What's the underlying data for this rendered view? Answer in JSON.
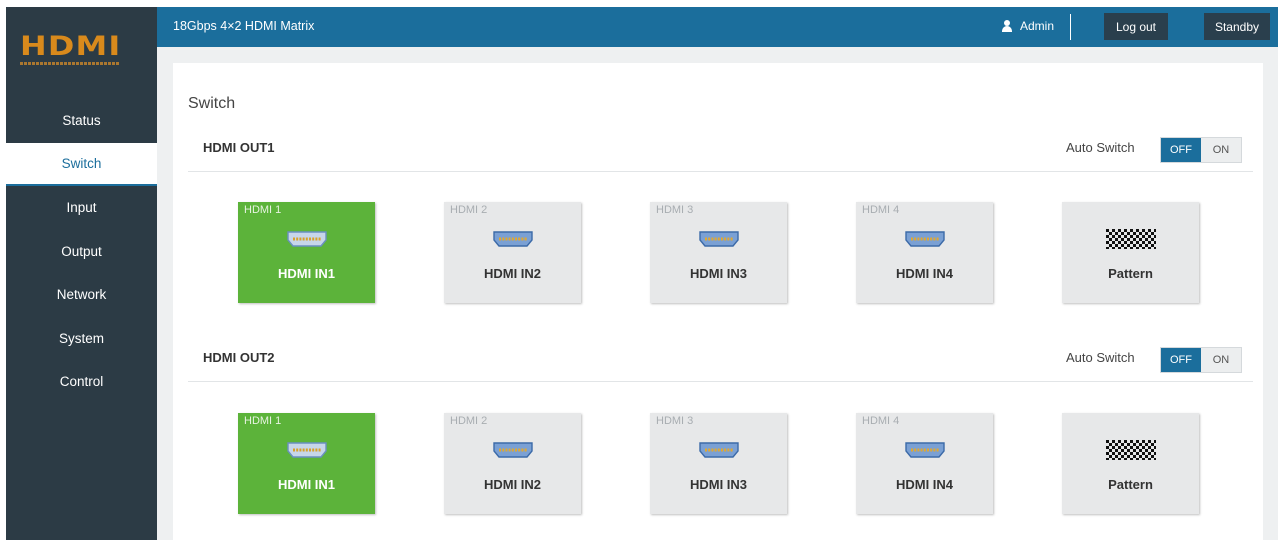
{
  "app": {
    "logo": "HDMI",
    "title": "18Gbps 4×2 HDMI Matrix",
    "user": "Admin",
    "logout_label": "Log out",
    "standby_label": "Standby"
  },
  "nav": {
    "items": [
      {
        "label": "Status",
        "active": false
      },
      {
        "label": "Switch",
        "active": true
      },
      {
        "label": "Input",
        "active": false
      },
      {
        "label": "Output",
        "active": false
      },
      {
        "label": "Network",
        "active": false
      },
      {
        "label": "System",
        "active": false
      },
      {
        "label": "Control",
        "active": false
      }
    ]
  },
  "page": {
    "title": "Switch",
    "outputs": [
      {
        "label": "HDMI OUT1",
        "auto_switch_label": "Auto Switch",
        "off_label": "OFF",
        "on_label": "ON",
        "auto_switch": "OFF",
        "sources": [
          {
            "tag": "HDMI 1",
            "name": "HDMI IN1",
            "icon": "hdmi-port-icon",
            "selected": true
          },
          {
            "tag": "HDMI 2",
            "name": "HDMI IN2",
            "icon": "hdmi-port-icon",
            "selected": false
          },
          {
            "tag": "HDMI 3",
            "name": "HDMI IN3",
            "icon": "hdmi-port-icon",
            "selected": false
          },
          {
            "tag": "HDMI 4",
            "name": "HDMI IN4",
            "icon": "hdmi-port-icon",
            "selected": false
          },
          {
            "tag": "",
            "name": "Pattern",
            "icon": "checker-pattern-icon",
            "selected": false
          }
        ]
      },
      {
        "label": "HDMI OUT2",
        "auto_switch_label": "Auto Switch",
        "off_label": "OFF",
        "on_label": "ON",
        "auto_switch": "OFF",
        "sources": [
          {
            "tag": "HDMI 1",
            "name": "HDMI IN1",
            "icon": "hdmi-port-icon",
            "selected": true
          },
          {
            "tag": "HDMI 2",
            "name": "HDMI IN2",
            "icon": "hdmi-port-icon",
            "selected": false
          },
          {
            "tag": "HDMI 3",
            "name": "HDMI IN3",
            "icon": "hdmi-port-icon",
            "selected": false
          },
          {
            "tag": "HDMI 4",
            "name": "HDMI IN4",
            "icon": "hdmi-port-icon",
            "selected": false
          },
          {
            "tag": "",
            "name": "Pattern",
            "icon": "checker-pattern-icon",
            "selected": false
          }
        ]
      }
    ]
  },
  "colors": {
    "header": "#1b6e9c",
    "sidebar": "#2c3b45",
    "selected_source": "#5cb33a",
    "logo": "#d98a1c"
  }
}
